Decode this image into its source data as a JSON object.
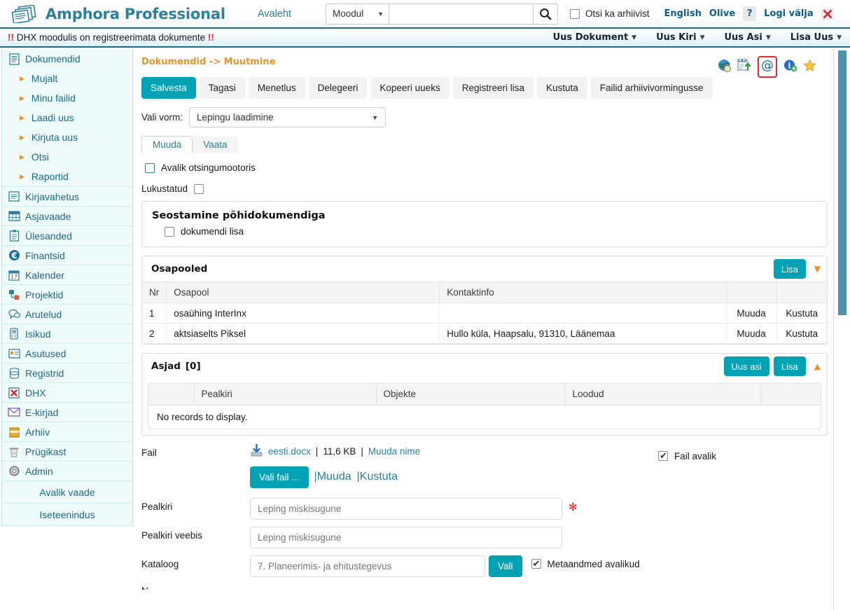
{
  "header": {
    "app_title": "Amphora Professional",
    "logo_icon": "documents-stack-icon",
    "nav_home": "Avaleht",
    "module_select": {
      "value": "Moodul",
      "caret": "▼"
    },
    "search": {
      "value": "",
      "placeholder": ""
    },
    "search_icon": "search-icon",
    "archive_checkbox": {
      "label": "Otsi ka arhiivist",
      "checked": false
    },
    "language_link": "English",
    "theme_link": "Olive",
    "help_badge": "?",
    "logout_link": "Logi välja",
    "logout_icon": "red-x-icon"
  },
  "alertbar": {
    "bang_left": "!!",
    "message": "DHX moodulis on registreerimata dokumente",
    "bang_right": "!!",
    "menus": [
      {
        "label": "Uus Dokument",
        "caret": "▼"
      },
      {
        "label": "Uus Kiri",
        "caret": "▼"
      },
      {
        "label": "Uus Asi",
        "caret": "▼"
      },
      {
        "label": "Lisa Uus",
        "caret": "▼"
      }
    ]
  },
  "sidebar": {
    "documents": {
      "label": "Dokumendid",
      "icon": "document-icon",
      "children": [
        {
          "label": "Mujalt",
          "icon": "arrow-right-icon"
        },
        {
          "label": "Minu failid",
          "icon": "arrow-right-icon"
        },
        {
          "label": "Laadi uus",
          "icon": "arrow-right-icon"
        },
        {
          "label": "Kirjuta uus",
          "icon": "arrow-right-icon"
        },
        {
          "label": "Otsi",
          "icon": "arrow-right-icon"
        },
        {
          "label": "Raportid",
          "icon": "arrow-right-icon"
        }
      ]
    },
    "items": [
      {
        "label": "Kirjavahetus",
        "icon": "letter-icon"
      },
      {
        "label": "Asjavaade",
        "icon": "table-icon"
      },
      {
        "label": "Ülesanded",
        "icon": "clipboard-icon"
      },
      {
        "label": "Finantsid",
        "icon": "euro-icon"
      },
      {
        "label": "Kalender",
        "icon": "calendar-icon"
      },
      {
        "label": "Projektid",
        "icon": "project-icon"
      },
      {
        "label": "Arutelud",
        "icon": "chat-icon"
      },
      {
        "label": "Isikud",
        "icon": "person-icon"
      },
      {
        "label": "Asutused",
        "icon": "organization-icon"
      },
      {
        "label": "Registrid",
        "icon": "database-icon"
      },
      {
        "label": "DHX",
        "icon": "dhx-icon"
      },
      {
        "label": "E-kirjad",
        "icon": "envelope-icon"
      },
      {
        "label": "Arhiiv",
        "icon": "archive-box-icon"
      },
      {
        "label": "Prügikast",
        "icon": "trash-icon"
      },
      {
        "label": "Admin",
        "icon": "gear-icon"
      }
    ],
    "plain_items": [
      {
        "label": "Avalik vaade"
      },
      {
        "label": "Iseteenindus"
      }
    ]
  },
  "main": {
    "breadcrumb": "Dokumendid -> Muutmine",
    "toolbar_icons": [
      {
        "name": "globe-icon"
      },
      {
        "name": "xml-export-icon"
      },
      {
        "name": "at-sign-icon",
        "highlighted": true,
        "highlight_color": "#e8242a"
      },
      {
        "name": "info-add-icon"
      },
      {
        "name": "star-favorite-icon"
      }
    ],
    "annotation": {
      "type": "arrow",
      "color": "#ee1c25",
      "points_to": "at-sign-icon"
    },
    "buttons": [
      {
        "label": "Salvesta",
        "primary": true
      },
      {
        "label": "Tagasi",
        "primary": false
      },
      {
        "label": "Menetlus",
        "primary": false
      },
      {
        "label": "Delegeeri",
        "primary": false
      },
      {
        "label": "Kopeeri uueks",
        "primary": false
      },
      {
        "label": "Registreeri lisa",
        "primary": false
      },
      {
        "label": "Kustuta",
        "primary": false
      },
      {
        "label": "Failid arhiivivormingusse",
        "primary": false
      }
    ],
    "form_select": {
      "label": "Vali vorm:",
      "value": "Lepingu laadimine",
      "caret": "▼"
    },
    "tabs": [
      {
        "label": "Muuda",
        "active": true
      },
      {
        "label": "Vaata",
        "active": false
      }
    ],
    "public_search_checkbox": {
      "label": "Avalik otsingumootoris",
      "checked": false
    },
    "locked_checkbox": {
      "label": "Lukustatud",
      "checked": false
    },
    "relation_panel": {
      "title": "Seostamine põhidokumendiga",
      "checkbox": {
        "label": "dokumendi lisa",
        "checked": false
      }
    },
    "parties": {
      "title": "Osapooled",
      "add_button": "Lisa",
      "collapse_icon": "▼",
      "columns": [
        "Nr",
        "Osapool",
        "Kontaktinfo",
        "",
        ""
      ],
      "rows": [
        {
          "nr": "1",
          "party": "osaühing InterInx",
          "contact": "",
          "edit": "Muuda",
          "delete": "Kustuta"
        },
        {
          "nr": "2",
          "party": "aktsiaselts Piksel",
          "contact": "Hullo küla, Haapsalu, 91310, Läänemaa",
          "edit": "Muuda",
          "delete": "Kustuta"
        }
      ]
    },
    "cases": {
      "title": "Asjad",
      "count": "[0]",
      "new_button": "Uus asi",
      "add_button": "Lisa",
      "collapse_icon": "▲",
      "columns": [
        "",
        "Pealkiri",
        "Objekte",
        "Loodud",
        ""
      ],
      "empty_message": "No records to display."
    },
    "file_section": {
      "label": "Fail",
      "download_icon": "download-icon",
      "file_name": "eesti.docx",
      "separator_1": "|",
      "file_size": "11,6 KB",
      "separator_2": "|",
      "rename_link": "Muuda nime",
      "choose_button": "Vali fail ...",
      "edit_link": "|Muuda",
      "delete_link": "|Kustuta",
      "public_checkbox": {
        "label": "Fail avalik",
        "checked": true
      }
    },
    "fields": [
      {
        "label": "Pealkiri",
        "value": "Leping miskisugune",
        "required": true
      },
      {
        "label": "Pealkiri veebis",
        "value": "Leping miskisugune",
        "required": false
      }
    ],
    "catalog": {
      "label": "Kataloog",
      "value": "7. Planeerimis- ja ehitustegevus",
      "button": "Vali",
      "checkbox": {
        "label": "Metaandmed avalikud",
        "checked": true
      }
    },
    "cut_off_label": "N"
  },
  "colors": {
    "accent_teal": "#00a2b4",
    "header_blue": "#2e7f9e",
    "link_blue": "#2b7e9c",
    "orange": "#e8922c",
    "alert_red": "#e8242a",
    "sidebar_bg": "#effbfb",
    "scrollbar": "#4e93aa"
  }
}
